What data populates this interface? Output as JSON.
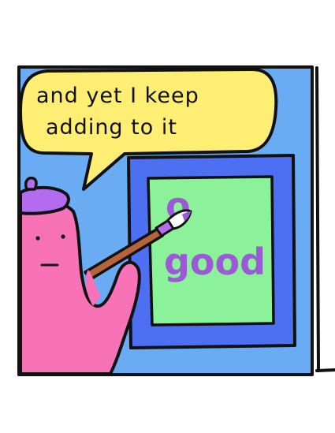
{
  "speech_bubble": {
    "line1": "and yet I keep",
    "line2": "adding to it"
  },
  "painting": {
    "word": "good",
    "overpainted_letter": "o"
  },
  "colors": {
    "background_wall": "#6AACF4",
    "speech_bubble": "#FFEE74",
    "canvas_frame": "#4D6FF2",
    "canvas_surface": "#8CF29A",
    "paint_text": "#9B59D6",
    "character_body": "#F772B6",
    "beret": "#B36CF0",
    "brush_handle": "#B8643A"
  }
}
